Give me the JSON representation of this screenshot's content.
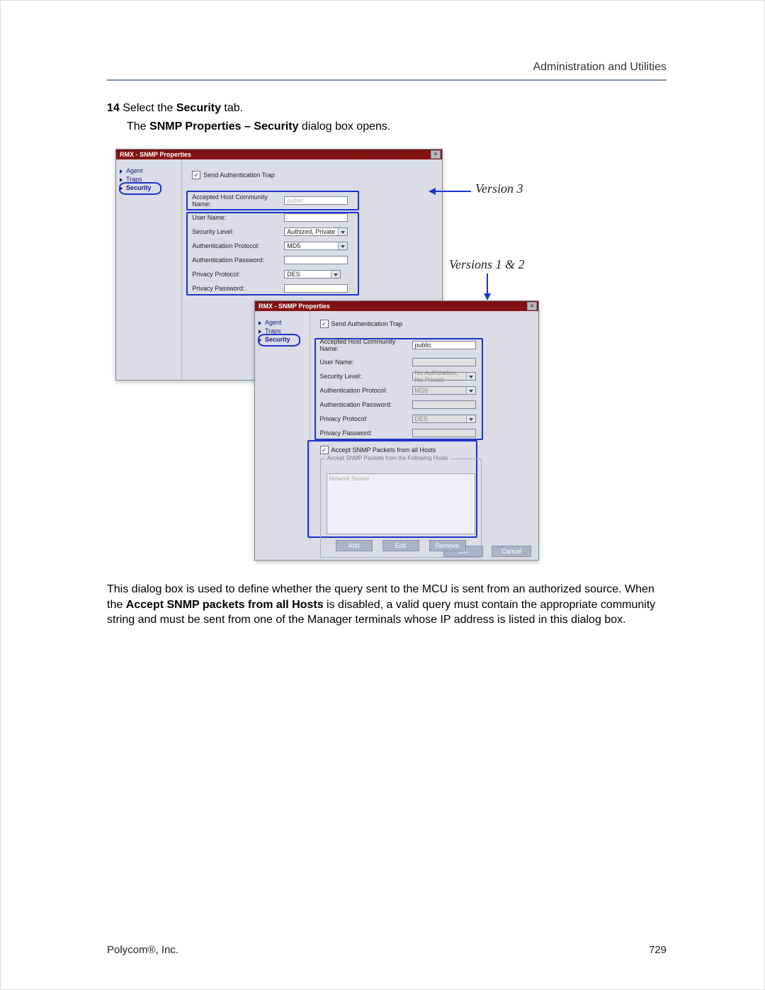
{
  "header": {
    "title": "Administration and Utilities"
  },
  "step": {
    "num": "14",
    "text_pre": " Select the ",
    "text_bold": "Security",
    "text_post": " tab.",
    "sub_pre": "The ",
    "sub_bold": "SNMP Properties – Security",
    "sub_post": " dialog box opens."
  },
  "dlg": {
    "title": "RMX - SNMP Properties",
    "close": "×",
    "nav": {
      "agent": "Agent",
      "traps": "Traps",
      "security": "Security"
    },
    "chk_label": "Send Authentication Trap",
    "labels": {
      "community": "Accepted Host Community Name:",
      "username": "User Name:",
      "seclevel": "Security Level:",
      "authproto": "Authentication Protocol:",
      "authpass": "Authentication Password:",
      "privproto": "Privacy Protocol:",
      "privpass": "Privacy Password:"
    }
  },
  "dlg1": {
    "community": "public",
    "seclevel": "Authized, Private",
    "authproto": "MD5",
    "privproto": "DES"
  },
  "dlg2": {
    "community": "public",
    "seclevel": "No Authization, No Private",
    "authproto": "MD5",
    "privproto": "DES",
    "accept_all": "Accept SNMP Packets from all Hosts",
    "group_title": "Accept SNMP Packets from the Following Hosts",
    "placeholder": "Network Source",
    "add": "Add",
    "edit": "Edit",
    "remove": "Remove",
    "ok": "OK",
    "cancel": "Cancel"
  },
  "callouts": {
    "v3": "Version 3",
    "v12": "Versions 1 & 2"
  },
  "para": {
    "p1": "This dialog box is used to define whether the query sent to the MCU is sent from an authorized source. When the ",
    "b1": "Accept SNMP packets from all Hosts",
    "p2": " is disabled, a valid query must contain the appropriate community string and must be sent from one of the Manager terminals whose IP address is listed in this dialog box."
  },
  "footer": {
    "left": "Polycom®, Inc.",
    "right": "729"
  }
}
